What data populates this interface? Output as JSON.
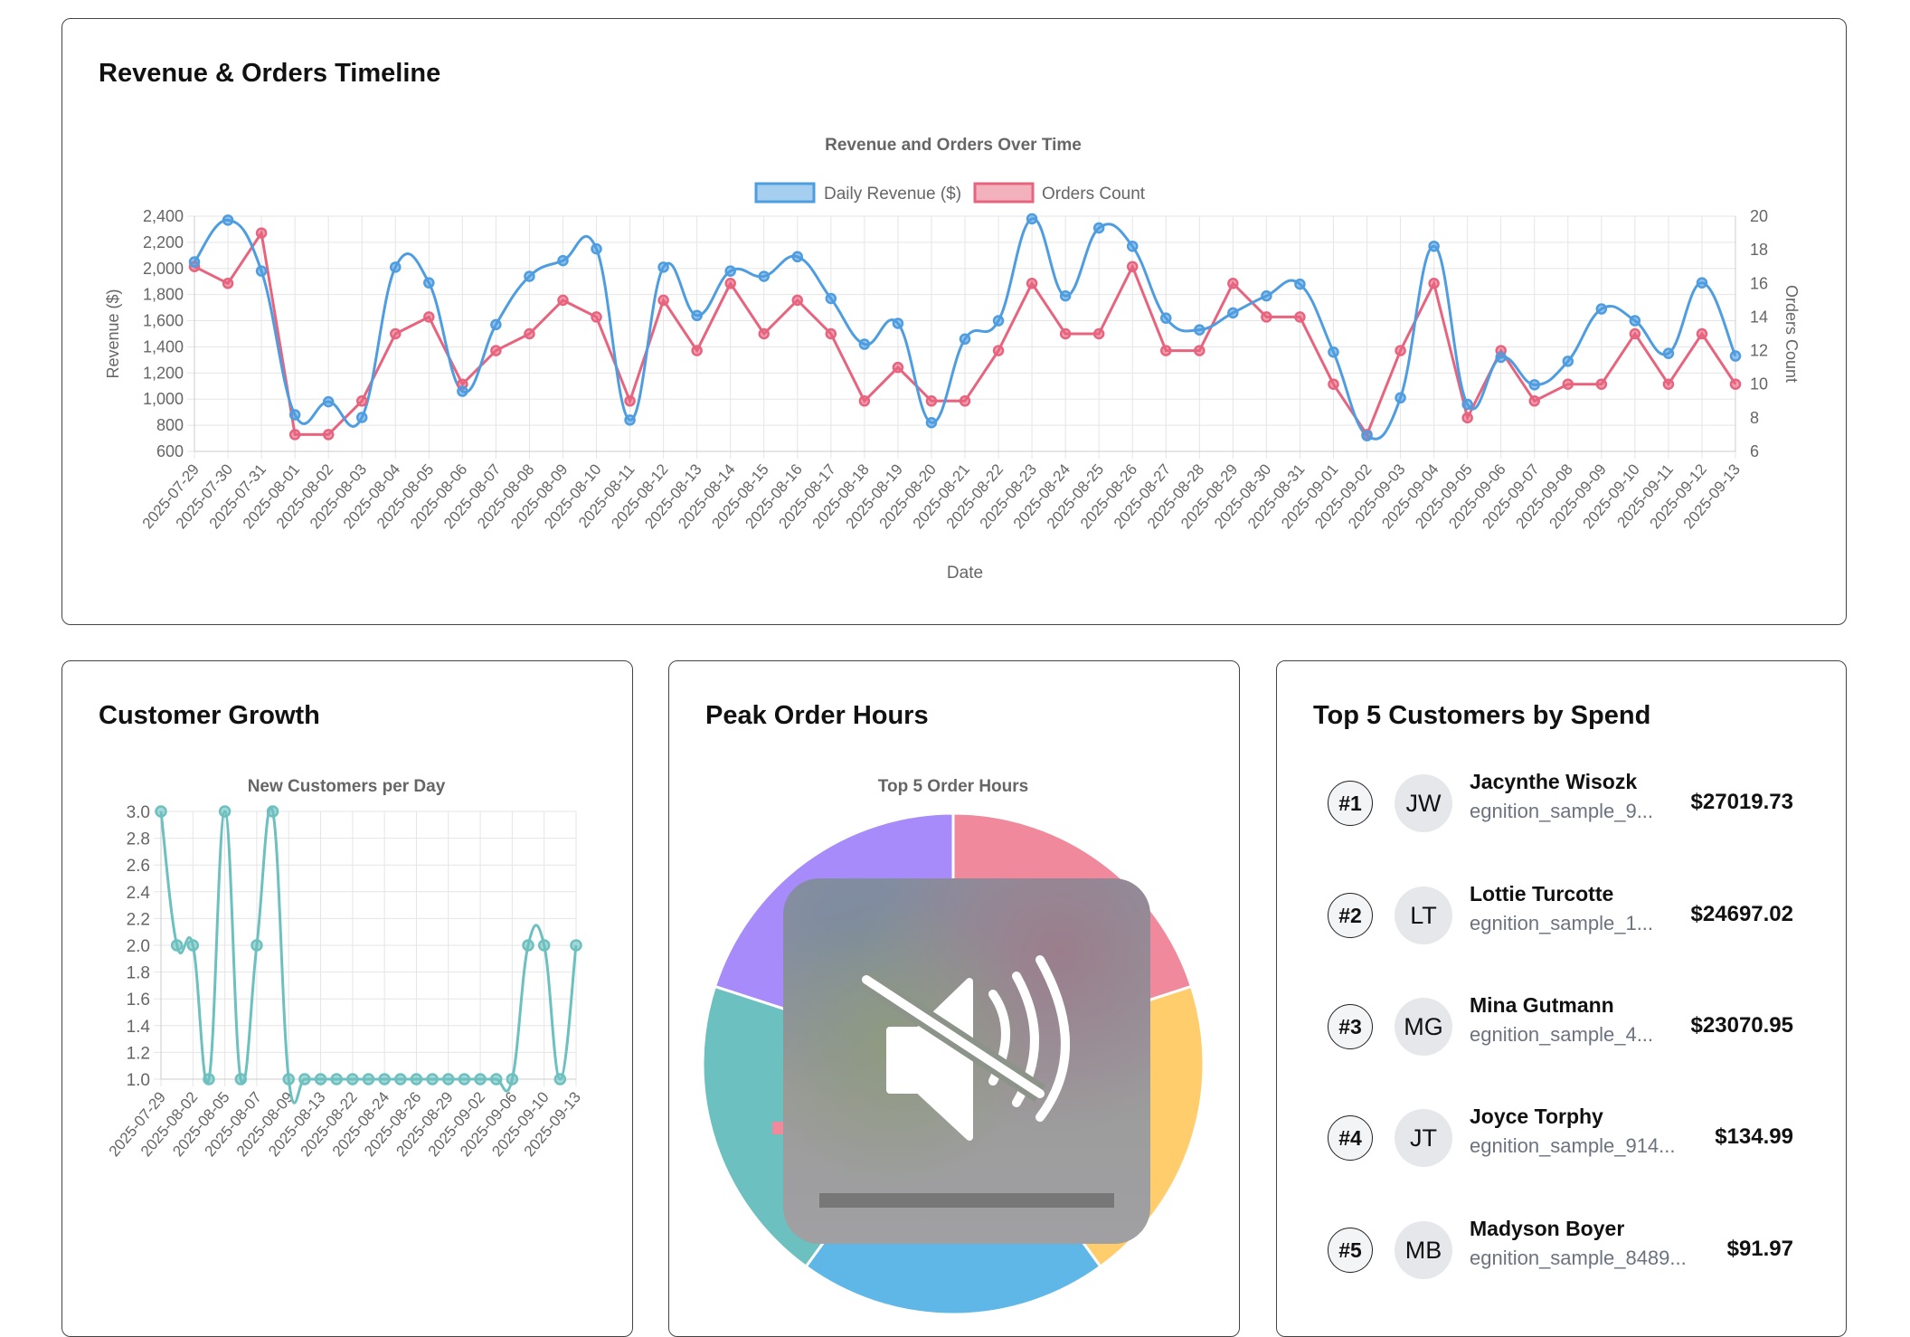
{
  "timeline_card": {
    "title": "Revenue & Orders Timeline"
  },
  "growth_card": {
    "title": "Customer Growth"
  },
  "hours_card": {
    "title": "Peak Order Hours"
  },
  "customers_card": {
    "title": "Top 5 Customers by Spend",
    "customers": [
      {
        "rank": "#1",
        "initials": "JW",
        "name": "Jacynthe Wisozk",
        "email": "egnition_sample_9...",
        "spend": "$27019.73"
      },
      {
        "rank": "#2",
        "initials": "LT",
        "name": "Lottie Turcotte",
        "email": "egnition_sample_1...",
        "spend": "$24697.02"
      },
      {
        "rank": "#3",
        "initials": "MG",
        "name": "Mina Gutmann",
        "email": "egnition_sample_4...",
        "spend": "$23070.95"
      },
      {
        "rank": "#4",
        "initials": "JT",
        "name": "Joyce Torphy",
        "email": "egnition_sample_914...",
        "spend": "$134.99"
      },
      {
        "rank": "#5",
        "initials": "MB",
        "name": "Madyson Boyer",
        "email": "egnition_sample_8489...",
        "spend": "$91.97"
      }
    ]
  },
  "overlay": {
    "icon": "speaker-muted-icon",
    "volume_level": 0
  },
  "chart_data": [
    {
      "type": "line",
      "title": "Revenue and Orders Over Time",
      "xlabel": "Date",
      "ylabel": "Revenue ($)",
      "y2label": "Orders Count",
      "ylim": [
        600,
        2400
      ],
      "y2lim": [
        6,
        20
      ],
      "yticks": [
        "600",
        "800",
        "1,000",
        "1,200",
        "1,400",
        "1,600",
        "1,800",
        "2,000",
        "2,200",
        "2,400"
      ],
      "y2ticks": [
        "6",
        "8",
        "10",
        "12",
        "14",
        "16",
        "18",
        "20"
      ],
      "grid": true,
      "legend": "top",
      "categories": [
        "2025-07-29",
        "2025-07-30",
        "2025-07-31",
        "2025-08-01",
        "2025-08-02",
        "2025-08-03",
        "2025-08-04",
        "2025-08-05",
        "2025-08-06",
        "2025-08-07",
        "2025-08-08",
        "2025-08-09",
        "2025-08-10",
        "2025-08-11",
        "2025-08-12",
        "2025-08-13",
        "2025-08-14",
        "2025-08-15",
        "2025-08-16",
        "2025-08-17",
        "2025-08-18",
        "2025-08-19",
        "2025-08-20",
        "2025-08-21",
        "2025-08-22",
        "2025-08-23",
        "2025-08-24",
        "2025-08-25",
        "2025-08-26",
        "2025-08-27",
        "2025-08-28",
        "2025-08-29",
        "2025-08-30",
        "2025-08-31",
        "2025-09-01",
        "2025-09-02",
        "2025-09-03",
        "2025-09-04",
        "2025-09-05",
        "2025-09-06",
        "2025-09-07",
        "2025-09-08",
        "2025-09-09",
        "2025-09-10",
        "2025-09-11",
        "2025-09-12",
        "2025-09-13"
      ],
      "series": [
        {
          "name": "Daily Revenue ($)",
          "axis": "left",
          "color": "#4e9de0",
          "values": [
            2050,
            2370,
            1980,
            880,
            980,
            860,
            2010,
            1890,
            1060,
            1570,
            1940,
            2060,
            2150,
            840,
            2010,
            1640,
            1980,
            1940,
            2090,
            1770,
            1420,
            1580,
            820,
            1460,
            1600,
            2380,
            1790,
            2310,
            2170,
            1620,
            1530,
            1660,
            1790,
            1880,
            1360,
            720,
            1010,
            2170,
            960,
            1320,
            1110,
            1290,
            1690,
            1600,
            1350,
            1890,
            1330
          ]
        },
        {
          "name": "Orders Count",
          "axis": "right",
          "color": "#e8647e",
          "values": [
            17,
            16,
            19,
            7,
            7,
            9,
            13,
            14,
            10,
            12,
            13,
            15,
            14,
            9,
            15,
            12,
            16,
            13,
            15,
            13,
            9,
            11,
            9,
            9,
            12,
            16,
            13,
            13,
            17,
            12,
            12,
            16,
            14,
            14,
            10,
            7,
            12,
            16,
            8,
            12,
            9,
            10,
            10,
            13,
            10,
            13,
            10
          ]
        }
      ]
    },
    {
      "type": "line",
      "title": "New Customers per Day",
      "ylim": [
        1.0,
        3.0
      ],
      "yticks": [
        "1.0",
        "1.2",
        "1.4",
        "1.6",
        "1.8",
        "2.0",
        "2.2",
        "2.4",
        "2.6",
        "2.8",
        "3.0"
      ],
      "grid": true,
      "tick_labels": [
        "2025-07-29",
        "2025-08-02",
        "2025-08-05",
        "2025-08-07",
        "2025-08-09",
        "2025-08-13",
        "2025-08-22",
        "2025-08-24",
        "2025-08-26",
        "2025-08-29",
        "2025-09-02",
        "2025-09-06",
        "2025-09-10",
        "2025-09-13"
      ],
      "series": [
        {
          "name": "New Customers",
          "color": "#6cc0bf",
          "values": [
            3,
            2,
            2,
            1,
            3,
            1,
            2,
            3,
            1,
            1,
            1,
            1,
            1,
            1,
            1,
            1,
            1,
            1,
            1,
            1,
            1,
            1,
            1,
            2,
            2,
            1,
            2
          ]
        }
      ]
    },
    {
      "type": "pie",
      "title": "Top 5 Order Hours",
      "slices": [
        {
          "value": 20,
          "color": "#f0899c"
        },
        {
          "value": 20,
          "color": "#ffcd6b"
        },
        {
          "value": 20,
          "color": "#5fb7e8"
        },
        {
          "value": 20,
          "color": "#6cc0bf"
        },
        {
          "value": 20,
          "color": "#a78bfa"
        }
      ]
    }
  ]
}
